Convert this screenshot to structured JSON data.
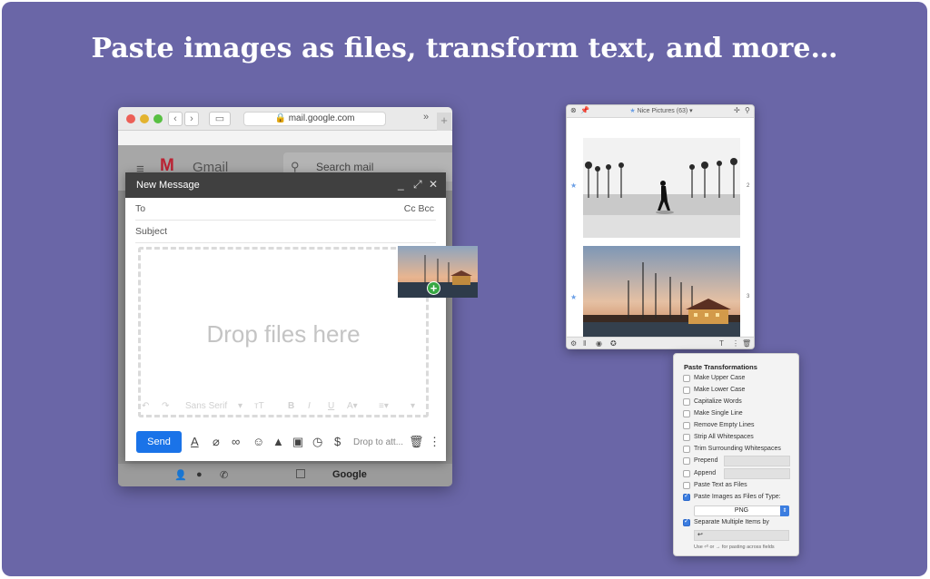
{
  "headline": "Paste images as files, transform text, and more…",
  "browser": {
    "url": "mail.google.com",
    "back_icon": "chevron-left-icon",
    "forward_icon": "chevron-right-icon",
    "more_label": "»",
    "new_tab_label": "+"
  },
  "gmail": {
    "logo_text": "Gmail",
    "search_placeholder": "Search mail",
    "bottom_account": "Google"
  },
  "compose": {
    "title": "New Message",
    "to_label": "To",
    "cc_bcc_label": "Cc Bcc",
    "subject_label": "Subject",
    "drop_text": "Drop files here",
    "font_label": "Sans Serif",
    "send_label": "Send",
    "drop_attach_label": "Drop to att..."
  },
  "clipboard": {
    "title": "Nice Pictures (63)",
    "items": [
      {
        "number": "2"
      },
      {
        "number": "3"
      }
    ]
  },
  "transformations": {
    "title": "Paste Transformations",
    "items": [
      {
        "label": "Make Upper Case",
        "checked": false
      },
      {
        "label": "Make Lower Case",
        "checked": false
      },
      {
        "label": "Capitalize Words",
        "checked": false
      },
      {
        "label": "Make Single Line",
        "checked": false
      },
      {
        "label": "Remove Empty Lines",
        "checked": false
      },
      {
        "label": "Strip All Whitespaces",
        "checked": false
      },
      {
        "label": "Trim Surrounding Whitespaces",
        "checked": false
      },
      {
        "label": "Prepend",
        "checked": false
      },
      {
        "label": "Append",
        "checked": false
      },
      {
        "label": "Paste Text as Files",
        "checked": false
      },
      {
        "label": "Paste Images as Files of Type:",
        "checked": true
      },
      {
        "label": "Separate Multiple Items by",
        "checked": true
      }
    ],
    "file_type": "PNG",
    "separator_value": "↩",
    "hint": "Use ⏎ or → for pasting across fields"
  },
  "colors": {
    "background": "#6a66a7",
    "send_button": "#1a73e8",
    "checkbox_on": "#3b7de0",
    "plus_badge": "#38a844"
  }
}
